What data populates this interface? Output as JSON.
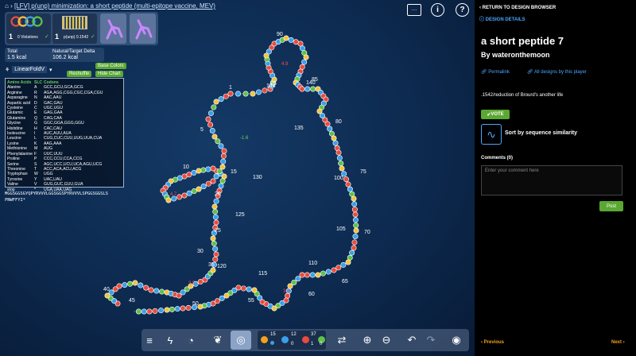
{
  "game": {
    "title_link": "[LFV] p(unp) minimization: a short peptide (multi-epitope vaccine, MEV)",
    "constraints": [
      {
        "count": "1",
        "label": "0 Violations",
        "check": "✓"
      },
      {
        "count": "1",
        "label": "p(unp) 0.1542",
        "check": "✓"
      }
    ],
    "stats": {
      "total_label": "Total",
      "total_value": "1.5 kcal",
      "delta_label": "Natural/Target Delta",
      "delta_value": "106.2 kcal"
    },
    "engine": "LinearFoldV",
    "buttons": {
      "base_colors": "Base Colors",
      "reshuffle": "Reshuffle",
      "hide_chart": "Hide Chart"
    },
    "codon_table": {
      "headers": [
        "Amino Acids",
        "SLC",
        "Codons"
      ],
      "rows": [
        [
          "Alanine",
          "A",
          "GCC,GCU,GCA,GCG"
        ],
        [
          "Arginine",
          "R",
          "AGA,AGG,CGG,CGC,CGA,CGU"
        ],
        [
          "Asparagine",
          "N",
          "AAC,AAU"
        ],
        [
          "Aspartic acid",
          "D",
          "GAC,GAU"
        ],
        [
          "Cysteine",
          "C",
          "UGC,UGU"
        ],
        [
          "Glutamic",
          "E",
          "GAG,GAA"
        ],
        [
          "Glutamine",
          "Q",
          "CAG,CAA"
        ],
        [
          "Glycine",
          "G",
          "GGC,GGA,GGG,GGU"
        ],
        [
          "Histidine",
          "H",
          "CAC,CAU"
        ],
        [
          "Isoleucine",
          "I",
          "AUC,AUU,AUA"
        ],
        [
          "Leucine",
          "L",
          "CUG,CUC,CUU,UUG,UUA,CUA"
        ],
        [
          "Lysine",
          "K",
          "AAG,AAA"
        ],
        [
          "Methionine",
          "M",
          "AUG"
        ],
        [
          "Phenylalanine",
          "F",
          "UUC,UUU"
        ],
        [
          "Proline",
          "P",
          "CCC,CCU,CCA,CCG"
        ],
        [
          "Serine",
          "S",
          "AGC,UCC,UCU,UCA,AGU,UCG"
        ],
        [
          "Threonine",
          "T",
          "ACC,ACA,ACU,ACG"
        ],
        [
          "Tryptophan",
          "W",
          "UGG"
        ],
        [
          "Tyrosine",
          "Y",
          "UAC,UAU"
        ],
        [
          "Valine",
          "V",
          "GUG,GUC,GUU,GUA"
        ],
        [
          "stop",
          "*",
          "UGA,UAA,UAG"
        ]
      ]
    },
    "peptide_line1": "MGGSGGSGYQPYRVVVLGGSGGSPYRVVVLSPGGSGGSLS",
    "peptide_line2": "PNWFFYI*",
    "index_labels": [
      "1",
      "5",
      "10",
      "15",
      "20",
      "25",
      "30",
      "35",
      "40",
      "45",
      "50",
      "55",
      "60",
      "65",
      "70",
      "75",
      "80",
      "85",
      "90",
      "95",
      "100",
      "105",
      "110",
      "115",
      "120",
      "125",
      "130",
      "135",
      "140",
      "144"
    ],
    "energy_labels": [
      "4.9",
      "-1.6",
      "4.7",
      "3.2",
      "3.5"
    ],
    "toolbar": {
      "palette_counts": [
        "15",
        "12",
        "37",
        "0",
        "1",
        "0"
      ]
    }
  },
  "side": {
    "return_link": "RETURN TO DESIGN BROWSER",
    "details_link": "DESIGN DETAILS",
    "design_title": "a short peptide 7",
    "author": "By wateronthemoon",
    "permalink": "Permalink",
    "all_designs": "All designs by this player",
    "description": ".1542/reduction of Brourd's another life",
    "vote": "VOTE",
    "sort_label": "Sort by sequence similarity",
    "comments_header": "Comments (0)",
    "comment_placeholder": "Enter your comment here",
    "post": "Post",
    "previous": "Previous",
    "next": "Next",
    "colors": {
      "link": "#4aa7ff",
      "vote_green": "#5aa832"
    }
  }
}
